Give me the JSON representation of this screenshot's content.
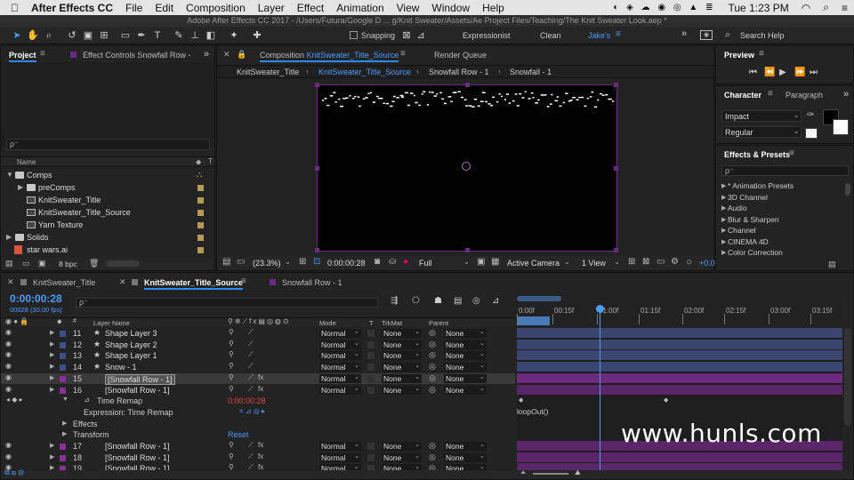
{
  "menubar": {
    "app": "After Effects CC",
    "items": [
      "File",
      "Edit",
      "Composition",
      "Layer",
      "Effect",
      "Animation",
      "View",
      "Window",
      "Help"
    ],
    "clock": "Tue 1:23 PM"
  },
  "titlebar": {
    "text": "Adobe After Effects CC 2017 - /Users/Futura/Google D ... g/Knit Sweater/Assets/Ae Project Files/Teaching/The Knit Sweater Look.aep *"
  },
  "toolbar": {
    "snapping": "Snapping",
    "workspaces": [
      "Expressionist",
      "Clean",
      "Jake's"
    ],
    "search_placeholder": "Search Help"
  },
  "project": {
    "tab": "Project",
    "effect_tab": "Effect Controls Snowfall Row -",
    "search_placeholder": "ρ",
    "col_name": "Name",
    "items": [
      {
        "label": "Comps",
        "kind": "folder",
        "open": true,
        "indent": 0
      },
      {
        "label": "preComps",
        "kind": "folder",
        "open": false,
        "indent": 1
      },
      {
        "label": "KnitSweater_Title",
        "kind": "comp",
        "indent": 1
      },
      {
        "label": "KnitSweater_Title_Source",
        "kind": "comp",
        "indent": 1
      },
      {
        "label": "Yarn Texture",
        "kind": "comp",
        "indent": 1
      },
      {
        "label": "Solids",
        "kind": "folder",
        "open": false,
        "indent": 0
      },
      {
        "label": "star wars.ai",
        "kind": "ai",
        "indent": 0
      }
    ],
    "bpc": "8 bpc"
  },
  "composition": {
    "tab_prefix": "Composition",
    "tab_name": "KnitSweater_Title_Source",
    "render_queue": "Render Queue",
    "breadcrumbs": [
      "KnitSweater_Title",
      "KnitSweater_Title_Source",
      "Snowfall Row - 1",
      "Snowfall - 1"
    ],
    "zoom": "(23.3%)",
    "time": "0:00:00:28",
    "resolution": "Full",
    "camera": "Active Camera",
    "views": "1 View",
    "offset": "+0.0"
  },
  "preview": {
    "title": "Preview"
  },
  "character": {
    "tab": "Character",
    "tab2": "Paragraph",
    "font": "Impact",
    "style": "Regular"
  },
  "effects": {
    "title": "Effects & Presets",
    "items": [
      "* Animation Presets",
      "3D Channel",
      "Audio",
      "Blur & Sharpen",
      "Channel",
      "CINEMA 4D",
      "Color Correction"
    ]
  },
  "timeline": {
    "tabs": [
      "KnitSweater_Title",
      "KnitSweater_Title_Source",
      "Snowfall Row - 1"
    ],
    "time": "0:00:00:28",
    "fps": "00028 (30.00 fps)",
    "headers": {
      "layer": "Layer Name",
      "mode": "Mode",
      "t": "T",
      "trkmat": "TrkMat",
      "parent": "Parent"
    },
    "ruler": [
      "0:00f",
      "00:15f",
      "01:00f",
      "01:15f",
      "02:00f",
      "02:15f",
      "03:00f",
      "03:15f"
    ],
    "layers": [
      {
        "num": "11",
        "name": "Shape Layer 3",
        "mode": "Normal",
        "trk": "None",
        "parent": "None",
        "star": true,
        "sel": false
      },
      {
        "num": "12",
        "name": "Shape Layer 2",
        "mode": "Normal",
        "trk": "None",
        "parent": "None",
        "star": true,
        "sel": false
      },
      {
        "num": "13",
        "name": "Shape Layer 1",
        "mode": "Normal",
        "trk": "None",
        "parent": "None",
        "star": true,
        "sel": false
      },
      {
        "num": "14",
        "name": "Snow - 1",
        "mode": "Normal",
        "trk": "None",
        "parent": "None",
        "star": true,
        "sel": false
      },
      {
        "num": "15",
        "name": "[Snowfall Row - 1]",
        "mode": "Normal",
        "trk": "None",
        "parent": "None",
        "star": false,
        "sel": true
      },
      {
        "num": "16",
        "name": "[Snowfall Row - 1]",
        "mode": "Normal",
        "trk": "None",
        "parent": "None",
        "star": false,
        "sel": false
      }
    ],
    "time_remap": "Time Remap",
    "time_remap_value": "0:00:00:28",
    "expression_label": "Expression: Time Remap",
    "effects_label": "Effects",
    "transform_label": "Transform",
    "reset": "Reset",
    "expression_text": "loopOut()",
    "layers2": [
      {
        "num": "17",
        "name": "[Snowfall Row - 1]",
        "mode": "Normal",
        "trk": "None",
        "parent": "None"
      },
      {
        "num": "18",
        "name": "[Snowfall Row - 1]",
        "mode": "Normal",
        "trk": "None",
        "parent": "None"
      },
      {
        "num": "19",
        "name": "[Snowfall Row - 1]",
        "mode": "Normal",
        "trk": "None",
        "parent": "None"
      }
    ]
  },
  "watermark": "www.hunls.com"
}
